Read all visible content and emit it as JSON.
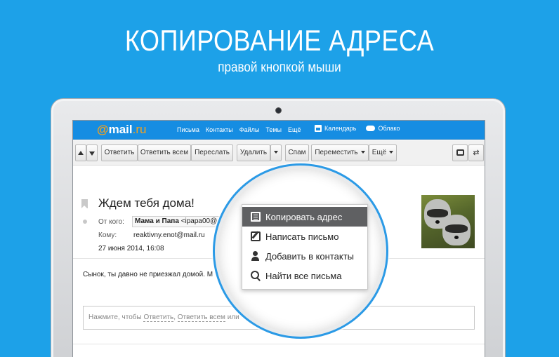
{
  "headline": "КОПИРОВАНИЕ АДРЕСА",
  "subline": "правой кнопкой мыши",
  "mail": {
    "logo_at": "@",
    "logo_main": "mail",
    "logo_ru": ".ru",
    "nav": [
      "Письма",
      "Контакты",
      "Файлы",
      "Темы",
      "Ещё"
    ],
    "calendar": "Календарь",
    "cloud": "Облако"
  },
  "toolbar": {
    "reply": "Ответить",
    "reply_all": "Ответить всем",
    "forward": "Переслать",
    "delete": "Удалить",
    "spam": "Спам",
    "move": "Переместить",
    "more": "Ещё"
  },
  "message": {
    "subject": "Ждем тебя дома!",
    "from_label": "От кого:",
    "from_name": "Мама и Папа",
    "from_email": "<ipapa00@",
    "to_label": "Кому:",
    "to_value": "reaktivny.enot@mail.ru",
    "date": "27 июня 2014, 16:08",
    "body": "Сынок, ты давно не приезжал домой. М",
    "reply_prefix": "Нажмите, чтобы ",
    "reply_link1": "Ответить",
    "reply_sep": ", ",
    "reply_link2": "Ответить всем",
    "reply_suffix": " или"
  },
  "context_menu": {
    "items": [
      {
        "label": "Копировать адрес",
        "icon": "copy-icon",
        "active": true
      },
      {
        "label": "Написать письмо",
        "icon": "write-icon",
        "active": false
      },
      {
        "label": "Добавить в контакты",
        "icon": "add-contact-icon",
        "active": false
      },
      {
        "label": "Найти все письма",
        "icon": "search-icon",
        "active": false
      }
    ]
  },
  "colors": {
    "background": "#1da1e8",
    "mail_nav": "#168de2",
    "logo_accent": "#f7a21b",
    "menu_active": "#5f6062"
  }
}
